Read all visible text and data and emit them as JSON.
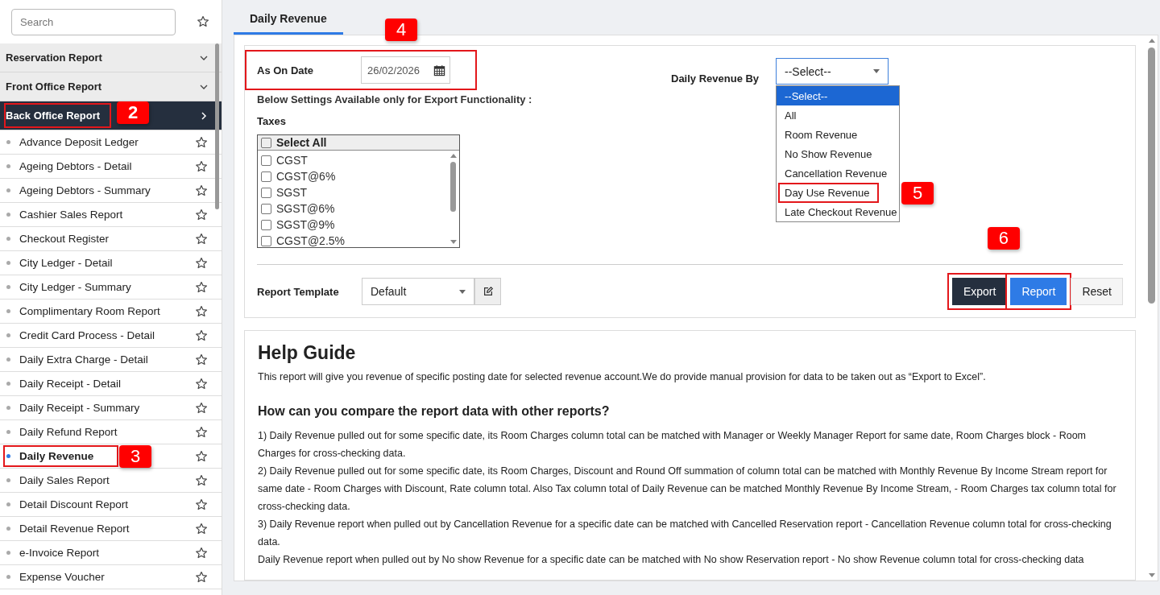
{
  "sidebar": {
    "search": {
      "placeholder": "Search"
    },
    "groups": [
      {
        "label": "Reservation Report",
        "selected": false
      },
      {
        "label": "Front Office Report",
        "selected": false
      },
      {
        "label": "Back Office Report",
        "selected": true,
        "callout": "2"
      }
    ],
    "items": [
      {
        "label": "Advance Deposit Ledger",
        "selected": false
      },
      {
        "label": "Ageing Debtors - Detail",
        "selected": false
      },
      {
        "label": "Ageing Debtors - Summary",
        "selected": false
      },
      {
        "label": "Cashier Sales Report",
        "selected": false
      },
      {
        "label": "Checkout Register",
        "selected": false
      },
      {
        "label": "City Ledger - Detail",
        "selected": false
      },
      {
        "label": "City Ledger - Summary",
        "selected": false
      },
      {
        "label": "Complimentary Room Report",
        "selected": false
      },
      {
        "label": "Credit Card Process - Detail",
        "selected": false
      },
      {
        "label": "Daily Extra Charge - Detail",
        "selected": false
      },
      {
        "label": "Daily Receipt - Detail",
        "selected": false
      },
      {
        "label": "Daily Receipt - Summary",
        "selected": false
      },
      {
        "label": "Daily Refund Report",
        "selected": false
      },
      {
        "label": "Daily Revenue",
        "selected": true,
        "callout": "3"
      },
      {
        "label": "Daily Sales Report",
        "selected": false
      },
      {
        "label": "Detail Discount Report",
        "selected": false
      },
      {
        "label": "Detail Revenue Report",
        "selected": false
      },
      {
        "label": "e-Invoice Report",
        "selected": false
      },
      {
        "label": "Expense Voucher",
        "selected": false
      }
    ]
  },
  "tabs": [
    {
      "label": "Daily Revenue",
      "selected": true
    }
  ],
  "form": {
    "date": {
      "label": "As On Date",
      "value": "26/02/2026",
      "callout": "4"
    },
    "revenue_by": {
      "label": "Daily Revenue By",
      "value": "--Select--",
      "expanded": true,
      "options": [
        {
          "label": "--Select--",
          "selected": true
        },
        {
          "label": "All",
          "selected": false
        },
        {
          "label": "Room Revenue",
          "selected": false
        },
        {
          "label": "No Show Revenue",
          "selected": false
        },
        {
          "label": "Cancellation Revenue",
          "selected": false
        },
        {
          "label": "Day Use Revenue",
          "selected": false,
          "callout": "5"
        },
        {
          "label": "Late Checkout Revenue",
          "selected": false
        }
      ]
    },
    "note": "Below Settings Available only for Export Functionality :",
    "taxes": {
      "label": "Taxes",
      "select_all": {
        "label": "Select All",
        "checked": false
      },
      "options": [
        {
          "label": "CGST",
          "checked": false
        },
        {
          "label": "CGST@6%",
          "checked": false
        },
        {
          "label": "SGST",
          "checked": false
        },
        {
          "label": "SGST@6%",
          "checked": false
        },
        {
          "label": "SGST@9%",
          "checked": false
        },
        {
          "label": "CGST@2.5%",
          "checked": false
        }
      ]
    },
    "template": {
      "label": "Report Template",
      "value": "Default"
    },
    "buttons_callout": "6",
    "buttons": [
      {
        "label": "Export",
        "kind": "dark",
        "highlighted": true
      },
      {
        "label": "Report",
        "kind": "primary",
        "highlighted": true
      },
      {
        "label": "Reset",
        "kind": "plain",
        "highlighted": false
      }
    ]
  },
  "help": {
    "title": "Help Guide",
    "intro": "This report will give you revenue of specific posting date for selected revenue account.We do provide manual provision for data to be taken out as “Export to Excel”.",
    "question": "How can you compare the report data with other reports?",
    "paragraphs": [
      "1) Daily Revenue pulled out for some specific date, its Room Charges column total can be matched with Manager or Weekly Manager Report for same date, Room Charges block - Room Charges for cross-checking data.",
      "2) Daily Revenue pulled out for some specific date, its Room Charges, Discount and Round Off summation of column total can be matched with Monthly Revenue By Income Stream report for same date - Room Charges with Discount, Rate column total. Also Tax column total of Daily Revenue can be matched Monthly Revenue By Income Stream, - Room Charges tax column total for cross-checking data.",
      "3) Daily Revenue report when pulled out by Cancellation Revenue for a specific date can be matched with Cancelled Reservation report - Cancellation Revenue column total for cross-checking data.",
      "Daily Revenue report when pulled out by No show Revenue for a specific date can be matched with No show Reservation report - No show Revenue column total for cross-checking data"
    ]
  }
}
